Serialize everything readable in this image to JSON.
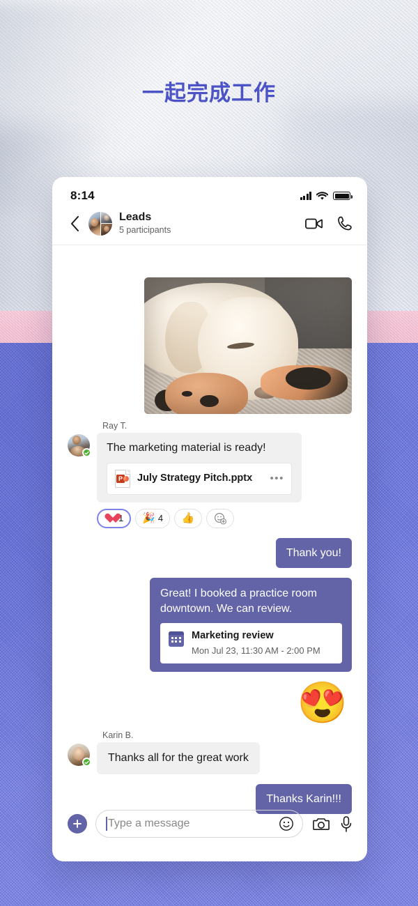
{
  "page": {
    "headline": "一起完成工作",
    "headline_color": "#4b53c7",
    "accent_purple": "#6264a7",
    "selected_reaction_border": "#7b83eb"
  },
  "statusbar": {
    "time": "8:14",
    "signal_icon": "cellular-bars-icon",
    "wifi_icon": "wifi-icon",
    "battery_icon": "battery-full-icon"
  },
  "chat_header": {
    "back_icon": "chevron-left-icon",
    "avatar_name": "group-avatar",
    "title": "Leads",
    "subtitle": "5 participants",
    "video_icon": "video-camera-icon",
    "call_icon": "phone-icon"
  },
  "thread": {
    "photo_message": {
      "alt": "sleeping-labrador-photo"
    },
    "messages": [
      {
        "sender": "Ray T.",
        "text": "The marketing material is ready!",
        "attachment": {
          "icon": "powerpoint-file-icon",
          "icon_letter": "P",
          "name": "July Strategy Pitch.pptx",
          "menu": "•••"
        },
        "reactions": [
          {
            "icon": "heart-reaction-icon",
            "emoji": "",
            "count": "1",
            "selected": true
          },
          {
            "icon": "party-popper-reaction-icon",
            "emoji": "🎉",
            "count": "4",
            "selected": false
          },
          {
            "icon": "thumbs-up-reaction-icon",
            "emoji": "👍",
            "count": "",
            "selected": false
          },
          {
            "icon": "add-reaction-icon",
            "emoji": "",
            "count": "",
            "selected": false
          }
        ]
      },
      {
        "outgoing": true,
        "text": "Thank you!"
      },
      {
        "outgoing": true,
        "text": "Great! I booked a practice room downtown. We can review.",
        "event": {
          "icon": "calendar-icon",
          "title": "Marketing review",
          "time": "Mon Jul 23, 11:30 AM - 2:00 PM"
        }
      },
      {
        "outgoing": true,
        "sticker": "😍",
        "sticker_name": "heart-eyes-emoji-sticker"
      },
      {
        "sender": "Karin B.",
        "text": "Thanks all for the great work"
      },
      {
        "outgoing": true,
        "text": "Thanks Karin!!!"
      }
    ]
  },
  "compose": {
    "add_label": "+",
    "add_icon": "plus-icon",
    "input_value": "",
    "placeholder": "Type a message",
    "emoji_icon": "smiley-icon",
    "camera_icon": "camera-icon",
    "mic_icon": "microphone-icon"
  }
}
